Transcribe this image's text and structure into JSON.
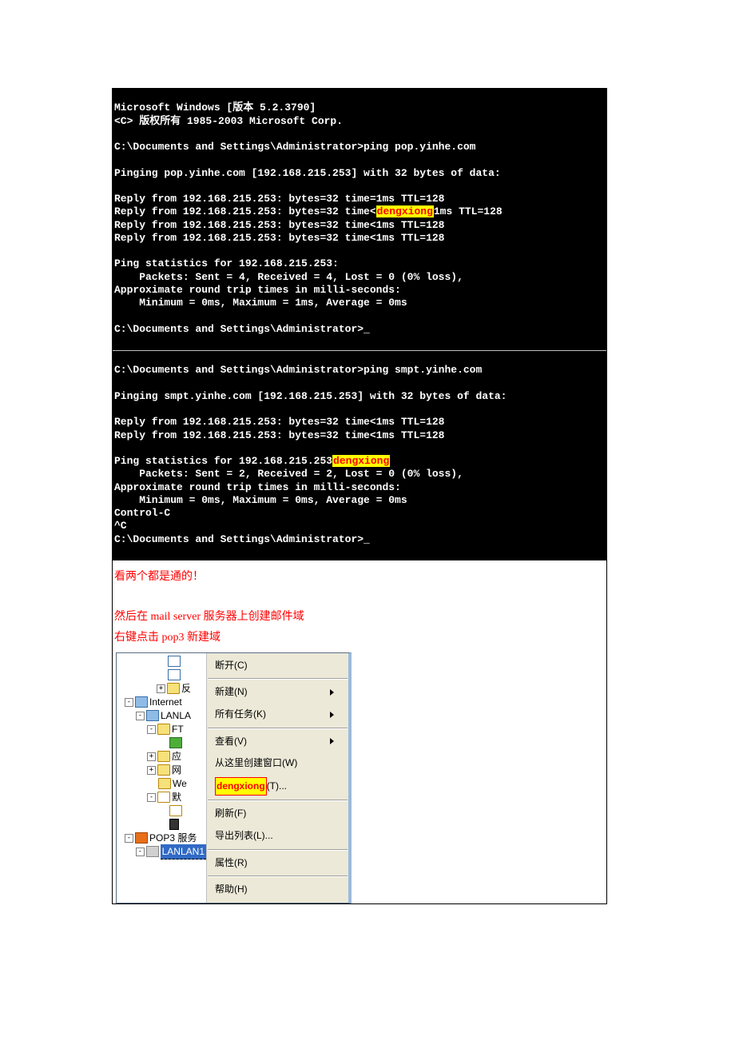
{
  "terminal": {
    "l0": "Microsoft Windows [版本 5.2.3790]",
    "l1": "<C> 版权所有 1985-2003 Microsoft Corp.",
    "l2": "",
    "l3": "C:\\Documents and Settings\\Administrator>ping pop.yinhe.com",
    "l4": "",
    "l5": "Pinging pop.yinhe.com [192.168.215.253] with 32 bytes of data:",
    "l6": "",
    "l7": "Reply from 192.168.215.253: bytes=32 time=1ms TTL=128",
    "l8a": "Reply from 192.168.215.253: bytes=32 time<",
    "hl1": "dengxiong",
    "l8b": "1ms TTL=128",
    "l9a": "Reply from 192.168.215.253: bytes=32 time<",
    "l9b": "1ms TTL=128",
    "l10": "Reply from 192.168.215.253: bytes=32 time<1ms TTL=128",
    "l11": "",
    "l12": "Ping statistics for 192.168.215.253:",
    "l13": "    Packets: Sent = 4, Received = 4, Lost = 0 (0% loss),",
    "l14": "Approximate round trip times in milli-seconds:",
    "l15": "    Minimum = 0ms, Maximum = 1ms, Average = 0ms",
    "l16": "",
    "l17": "C:\\Documents and Settings\\Administrator>_",
    "sep": "",
    "l18": "C:\\Documents and Settings\\Administrator>ping smpt.yinhe.com",
    "l19": "",
    "l20": "Pinging smpt.yinhe.com [192.168.215.253] with 32 bytes of data:",
    "l21": "",
    "l22": "Reply from 192.168.215.253: bytes=32 time<1ms TTL=128",
    "l23": "Reply from 192.168.215.253: bytes=32 time<1ms TTL=128",
    "l24": "",
    "l25a": "Ping statistics for 192.168.215.253",
    "hl2": "dengxiong",
    "l26": "    Packets: Sent = 2, Received = 2, Lost = 0 (0% loss),",
    "l27": "Approximate round trip times in milli-seconds:",
    "l28": "    Minimum = 0ms, Maximum = 0ms, Average = 0ms",
    "l29": "Control-C",
    "l30": "^C",
    "l31": "C:\\Documents and Settings\\Administrator>_"
  },
  "text": {
    "p1": "看两个都是通的！",
    "p2": "然后在 mail server 服务器上创建邮件域",
    "p3": "右键点击 pop3 新建域"
  },
  "tree": {
    "n1": "反",
    "n2": "Internet",
    "n3": "LANLA",
    "n4": "FT",
    "n5": "应",
    "n6": "网",
    "n7": "We",
    "n8": "默",
    "n9": "POP3 服务",
    "n10": "LANLAN1"
  },
  "menu": {
    "m1": "断开(C)",
    "m2": "新建(N)",
    "m3": "所有任务(K)",
    "m4": "查看(V)",
    "m5": "从这里创建窗口(W)",
    "m6hl": "dengxiong",
    "m6b": "(T)...",
    "m7": "刷新(F)",
    "m8": "导出列表(L)...",
    "m9": "属性(R)",
    "m10": "帮助(H)"
  }
}
